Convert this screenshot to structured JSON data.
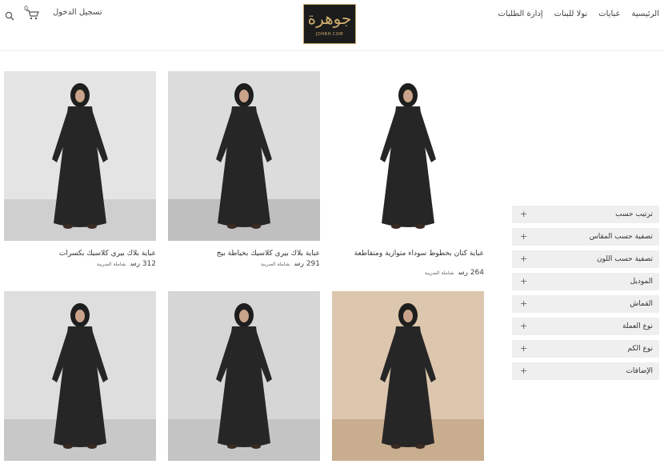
{
  "header": {
    "nav": [
      "الرئيسية",
      "عبايات",
      "نولا للبنات",
      "إدارة الطلبات"
    ],
    "logo_text": "جوهرة",
    "logo_sub": "JOHRH.COM",
    "login": "تسجيل الدخول",
    "cart_count": "0"
  },
  "filters": [
    {
      "label": "ترتيب حسب"
    },
    {
      "label": "تصفية حسب المقاس"
    },
    {
      "label": "تصفية حسب اللون"
    },
    {
      "label": "الموديل"
    },
    {
      "label": "القماش"
    },
    {
      "label": "نوع العملة"
    },
    {
      "label": "نوع الكم"
    },
    {
      "label": "الإضافات"
    }
  ],
  "products": [
    {
      "title": "عباية كتان بخطوط سوداء متوازية ومتقاطعة",
      "price": "264 رس",
      "tax": "شاملة الضريبة",
      "bg": "#ffffff",
      "floor": "#ffffff"
    },
    {
      "title": "عباية بلاك بيري كلاسيك بخياطة بيج",
      "price": "291 رس",
      "tax": "شاملة الضريبة",
      "bg": "#dcdcdc",
      "floor": "#bfbfbf"
    },
    {
      "title": "عباية بلاك بيري كلاسيك بكسرات",
      "price": "312 رس",
      "tax": "شاملة الضريبة",
      "bg": "#e4e4e4",
      "floor": "#cfcfcf"
    },
    {
      "title": "",
      "price": "",
      "tax": "",
      "bg": "#dcc6ad",
      "floor": "#c9ad8f"
    },
    {
      "title": "",
      "price": "",
      "tax": "",
      "bg": "#d6d6d6",
      "floor": "#c4c4c4"
    },
    {
      "title": "",
      "price": "",
      "tax": "",
      "bg": "#dedede",
      "floor": "#c8c8c8"
    }
  ],
  "plus_symbol": "+",
  "colors": {
    "gold": "#d4b06e",
    "logo_bg": "#1c1c1c",
    "filter_bg": "#efefef"
  }
}
